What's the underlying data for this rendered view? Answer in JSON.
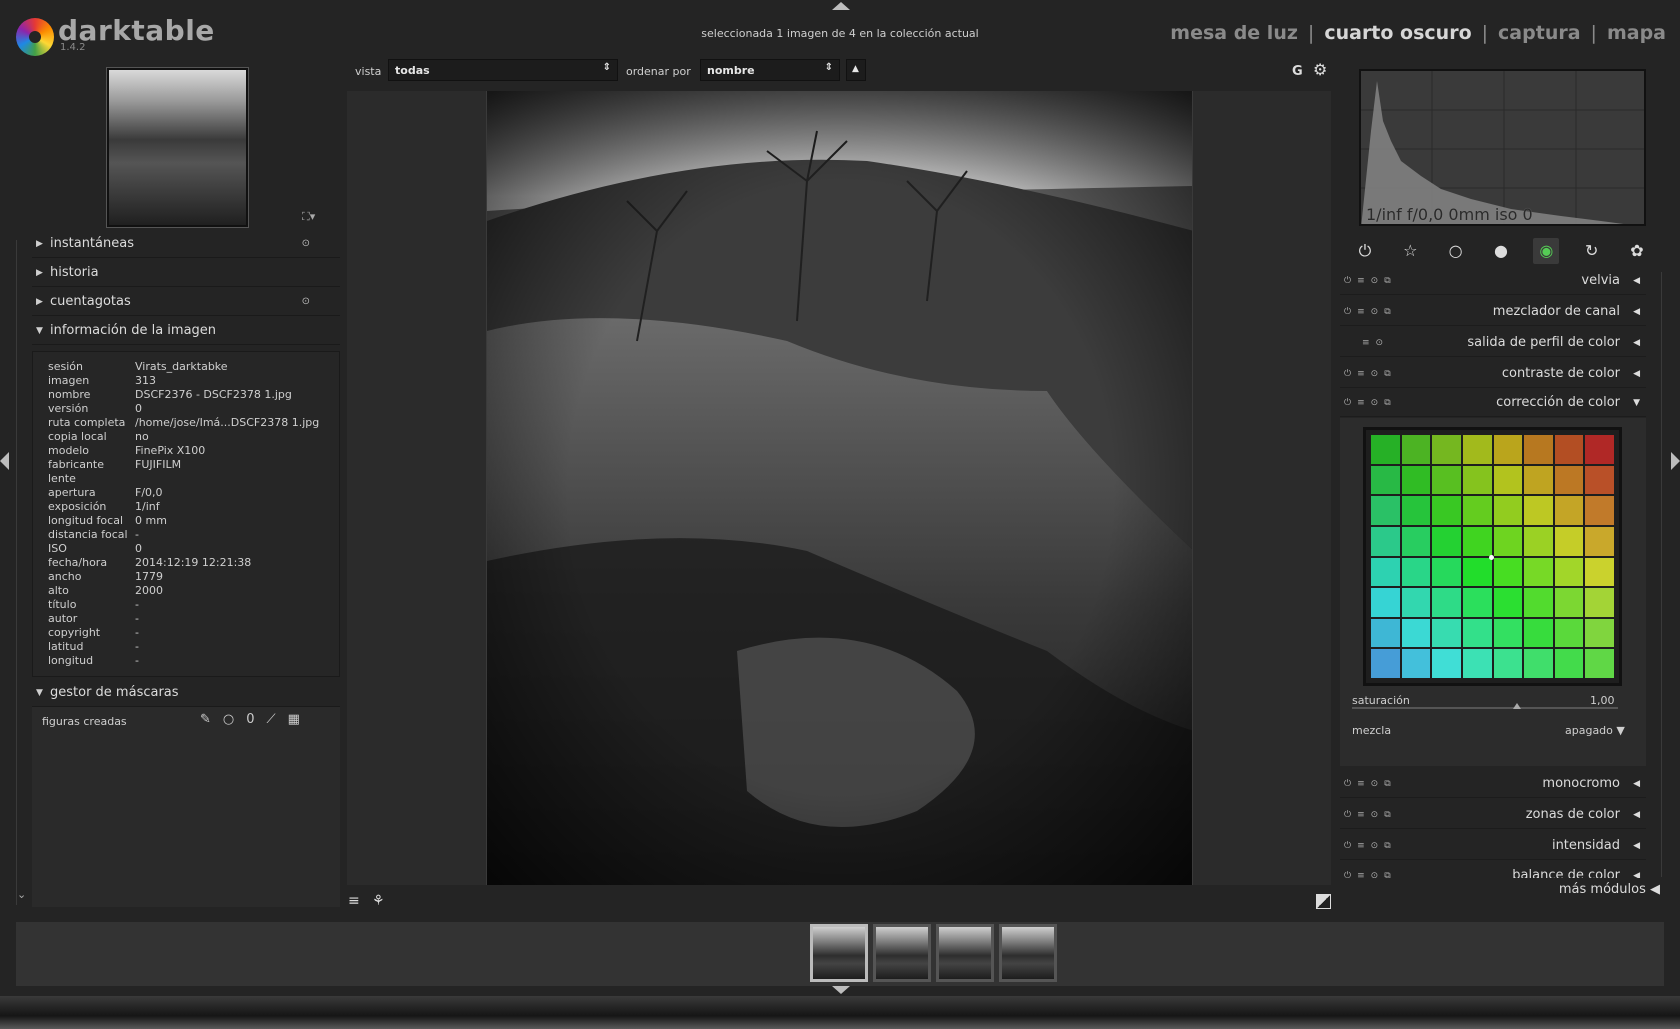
{
  "header": {
    "app_name": "darktable",
    "version": "1.4.2",
    "selection_info": "seleccionada 1 imagen de 4 en la colección actual",
    "views": [
      "mesa de luz",
      "cuarto oscuro",
      "captura",
      "mapa"
    ],
    "active_view": "cuarto oscuro",
    "separator": "|"
  },
  "filter": {
    "view_label": "vista",
    "view_value": "todas",
    "sort_label": "ordenar por",
    "sort_value": "nombre",
    "sort_dir": "▲",
    "g_label": "G"
  },
  "left_panel": {
    "sections": [
      {
        "label": "instantáneas",
        "expanded": false
      },
      {
        "label": "historia",
        "expanded": false
      },
      {
        "label": "cuentagotas",
        "expanded": false
      },
      {
        "label": "información de la imagen",
        "expanded": true
      },
      {
        "label": "gestor de máscaras",
        "expanded": true
      }
    ],
    "image_info": [
      [
        "sesión",
        "Virats_darktabke"
      ],
      [
        "imagen",
        "313"
      ],
      [
        "nombre",
        "DSCF2376 - DSCF2378 1.jpg"
      ],
      [
        "versión",
        "0"
      ],
      [
        "ruta completa",
        "/home/jose/Imá...DSCF2378 1.jpg"
      ],
      [
        "copia local",
        "no"
      ],
      [
        "modelo",
        "FinePix X100"
      ],
      [
        "fabricante",
        "FUJIFILM"
      ],
      [
        "lente",
        ""
      ],
      [
        "apertura",
        "F/0,0"
      ],
      [
        "exposición",
        "1/inf"
      ],
      [
        "longitud focal",
        "0 mm"
      ],
      [
        "distancia focal",
        "-"
      ],
      [
        "ISO",
        "0"
      ],
      [
        "fecha/hora",
        "2014:12:19 12:21:38"
      ],
      [
        "ancho",
        "1779"
      ],
      [
        "alto",
        "2000"
      ],
      [
        "título",
        "-"
      ],
      [
        "autor",
        "-"
      ],
      [
        "copyright",
        "-"
      ],
      [
        "latitud",
        "-"
      ],
      [
        "longitud",
        "-"
      ]
    ],
    "mask_label": "figuras creadas"
  },
  "histogram": {
    "exif": "1/inf f/0,0 0mm iso 0"
  },
  "right_panel": {
    "modules_top": [
      "velvia",
      "mezclador de canal",
      "salida de perfil de color",
      "contraste de color",
      "corrección de color"
    ],
    "modules_bottom": [
      "monocromo",
      "zonas de color",
      "intensidad",
      "balance de color"
    ],
    "saturation_label": "saturación",
    "saturation_value": "1,00",
    "saturation_level": 0.62,
    "mix_label": "mezcla",
    "mix_value": "apagado",
    "more_label": "más módulos"
  },
  "filmstrip": {
    "count": 4,
    "selected_index": 0
  }
}
